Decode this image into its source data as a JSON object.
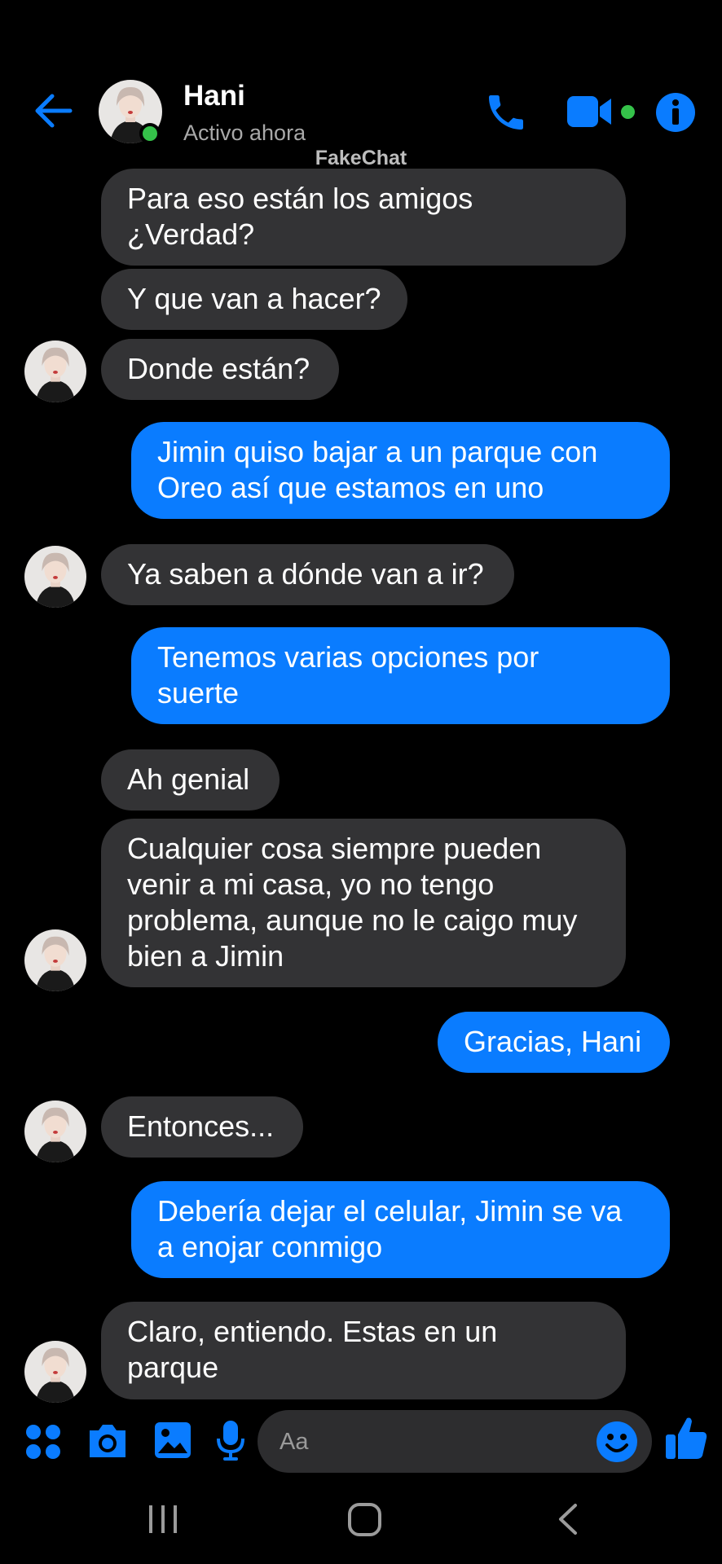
{
  "header": {
    "contact_name": "Hani",
    "status": "Activo ahora",
    "watermark": "FakeChat",
    "icons": [
      "back-arrow-icon",
      "phone-icon",
      "video-camera-icon",
      "info-icon"
    ],
    "accent_color": "#0a7cff",
    "online_color": "#35c24a"
  },
  "messages": [
    {
      "side": "in",
      "lines": [
        "Para eso están los amigos",
        "¿Verdad?"
      ]
    },
    {
      "side": "in",
      "lines": [
        "Y que van a hacer?"
      ]
    },
    {
      "side": "in",
      "lines": [
        "Donde están?"
      ]
    },
    {
      "side": "out",
      "lines": [
        "Jimin quiso bajar a un parque con",
        "Oreo así que estamos en uno"
      ]
    },
    {
      "side": "in",
      "lines": [
        "Ya saben a dónde van a ir?"
      ]
    },
    {
      "side": "out",
      "lines": [
        "Tenemos varias opciones por",
        "suerte"
      ]
    },
    {
      "side": "in",
      "lines": [
        "Ah genial"
      ]
    },
    {
      "side": "in",
      "lines": [
        "Cualquier cosa siempre pueden",
        "venir a mi casa, yo no tengo",
        "problema, aunque no le caigo muy",
        "bien a Jimin"
      ]
    },
    {
      "side": "out",
      "lines": [
        "Gracias, Hani"
      ]
    },
    {
      "side": "in",
      "lines": [
        "Entonces..."
      ]
    },
    {
      "side": "out",
      "lines": [
        "Debería dejar el celular, Jimin se va",
        "a enojar conmigo"
      ]
    },
    {
      "side": "in",
      "lines": [
        "Claro, entiendo. Estas en un",
        "parque"
      ]
    }
  ],
  "composer": {
    "placeholder": "Aa",
    "icons": [
      "apps-grid-icon",
      "camera-icon",
      "gallery-icon",
      "microphone-icon",
      "emoji-icon",
      "thumbs-up-icon"
    ]
  },
  "system_nav": {
    "icons": [
      "recent-apps-icon",
      "home-icon",
      "back-icon"
    ]
  }
}
